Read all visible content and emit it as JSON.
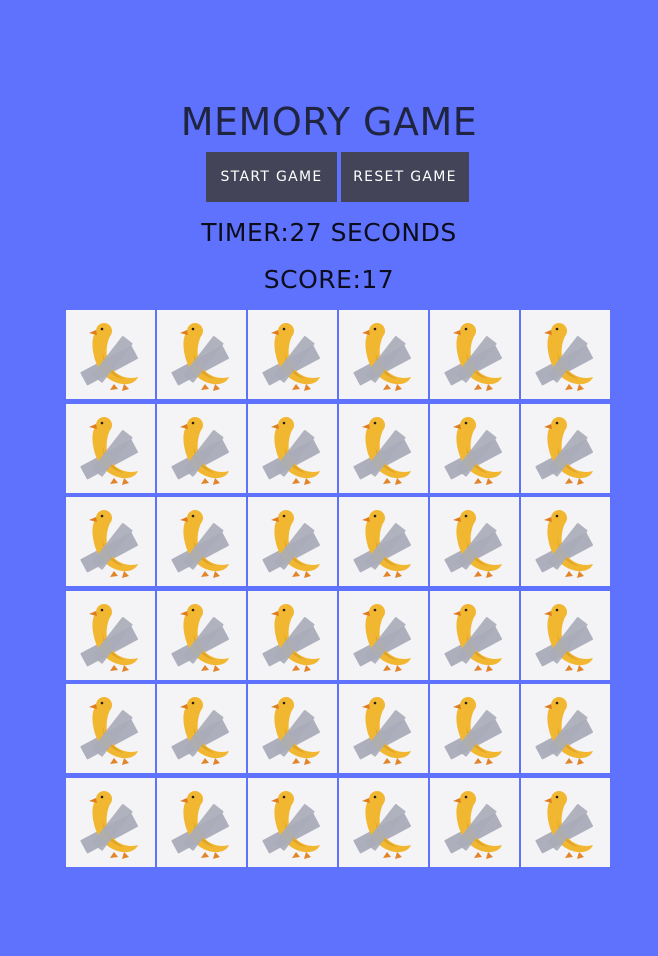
{
  "game": {
    "title": "MEMORY GAME",
    "start_label": "START GAME",
    "reset_label": "RESET GAME",
    "timer_label": "TIMER:",
    "timer_value": "27",
    "timer_unit": " SECONDS",
    "score_label": "SCORE:",
    "score_value": "17"
  },
  "board": {
    "rows": 6,
    "columns": 6,
    "card_icon": "duck-duct-tape-icon",
    "card_state": "face-down"
  },
  "colors": {
    "background": "#5e72fd",
    "button": "#434458",
    "card": "#f4f3f6",
    "duck": "#f2b731",
    "tape": "#a9acb8"
  }
}
